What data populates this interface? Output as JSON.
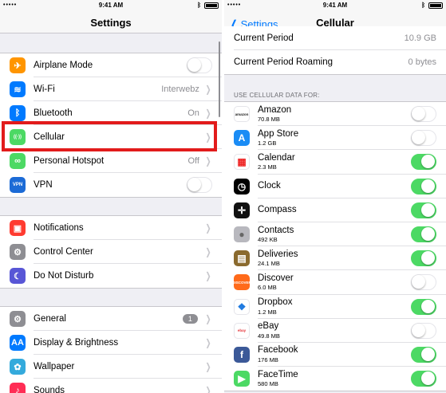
{
  "status": {
    "time": "9:41 AM",
    "carrier": "•••••"
  },
  "left": {
    "title": "Settings",
    "group1": [
      {
        "label": "Airplane Mode",
        "icon": "airplane-icon",
        "color": "#ff9500",
        "glyph": "✈",
        "type": "toggle",
        "on": false
      },
      {
        "label": "Wi-Fi",
        "icon": "wifi-icon",
        "color": "#007aff",
        "glyph": "≋",
        "type": "value",
        "value": "Interwebz"
      },
      {
        "label": "Bluetooth",
        "icon": "bluetooth-icon",
        "color": "#007aff",
        "glyph": "ᛒ",
        "type": "value",
        "value": "On"
      },
      {
        "label": "Cellular",
        "icon": "cellular-icon",
        "color": "#4cd964",
        "glyph": "((·))",
        "type": "chevron"
      },
      {
        "label": "Personal Hotspot",
        "icon": "hotspot-icon",
        "color": "#4cd964",
        "glyph": "∞",
        "type": "value",
        "value": "Off"
      },
      {
        "label": "VPN",
        "icon": "vpn-icon",
        "color": "#1c6bd6",
        "glyph": "VPN",
        "type": "toggle",
        "on": false
      }
    ],
    "group2": [
      {
        "label": "Notifications",
        "icon": "notifications-icon",
        "color": "#ff3b30",
        "glyph": "▣",
        "type": "chevron"
      },
      {
        "label": "Control Center",
        "icon": "control-center-icon",
        "color": "#8e8e93",
        "glyph": "⚙",
        "type": "chevron"
      },
      {
        "label": "Do Not Disturb",
        "icon": "moon-icon",
        "color": "#5856d6",
        "glyph": "☾",
        "type": "chevron"
      }
    ],
    "group3": [
      {
        "label": "General",
        "icon": "gear-icon",
        "color": "#8e8e93",
        "glyph": "⚙",
        "type": "badge",
        "badge": "1"
      },
      {
        "label": "Display & Brightness",
        "icon": "display-icon",
        "color": "#007aff",
        "glyph": "AA",
        "type": "chevron"
      },
      {
        "label": "Wallpaper",
        "icon": "wallpaper-icon",
        "color": "#34aadc",
        "glyph": "✿",
        "type": "chevron"
      },
      {
        "label": "Sounds",
        "icon": "sounds-icon",
        "color": "#ff2d55",
        "glyph": "♪",
        "type": "chevron"
      }
    ]
  },
  "right": {
    "back_label": "Settings",
    "title": "Cellular",
    "usage": [
      {
        "label": "Current Period",
        "value": "10.9 GB"
      },
      {
        "label": "Current Period Roaming",
        "value": "0 bytes"
      }
    ],
    "section_header": "USE CELLULAR DATA FOR:",
    "apps": [
      {
        "name": "Amazon",
        "size": "70.8 MB",
        "on": false,
        "icon": "amazon-icon",
        "color": "#ffffff",
        "fg": "#222",
        "glyph": "amazon"
      },
      {
        "name": "App Store",
        "size": "1.2 GB",
        "on": false,
        "icon": "app-store-icon",
        "color": "#1a8cf5",
        "fg": "#fff",
        "glyph": "A"
      },
      {
        "name": "Calendar",
        "size": "2.3 MB",
        "on": true,
        "icon": "calendar-icon",
        "color": "#ffffff",
        "fg": "#e22",
        "glyph": "▦"
      },
      {
        "name": "Clock",
        "size": "",
        "on": true,
        "icon": "clock-icon",
        "color": "#000000",
        "fg": "#fff",
        "glyph": "◷"
      },
      {
        "name": "Compass",
        "size": "",
        "on": true,
        "icon": "compass-icon",
        "color": "#111111",
        "fg": "#fff",
        "glyph": "✛"
      },
      {
        "name": "Contacts",
        "size": "492 KB",
        "on": true,
        "icon": "contacts-icon",
        "color": "#b8b8be",
        "fg": "#666",
        "glyph": "●"
      },
      {
        "name": "Deliveries",
        "size": "24.1 MB",
        "on": true,
        "icon": "deliveries-icon",
        "color": "#8a6a2e",
        "fg": "#fff",
        "glyph": "▤"
      },
      {
        "name": "Discover",
        "size": "6.0 MB",
        "on": false,
        "icon": "discover-icon",
        "color": "#ff6a1a",
        "fg": "#fff",
        "glyph": "DISCOVER"
      },
      {
        "name": "Dropbox",
        "size": "1.2 MB",
        "on": true,
        "icon": "dropbox-icon",
        "color": "#ffffff",
        "fg": "#1f7ae0",
        "glyph": "❖"
      },
      {
        "name": "eBay",
        "size": "49.8 MB",
        "on": false,
        "icon": "ebay-icon",
        "color": "#ffffff",
        "fg": "#e53238",
        "glyph": "ebay"
      },
      {
        "name": "Facebook",
        "size": "176 MB",
        "on": true,
        "icon": "facebook-icon",
        "color": "#3b5998",
        "fg": "#fff",
        "glyph": "f"
      },
      {
        "name": "FaceTime",
        "size": "580 MB",
        "on": true,
        "icon": "facetime-icon",
        "color": "#4cd964",
        "fg": "#fff",
        "glyph": "▶"
      }
    ]
  },
  "colors": {
    "accent": "#007aff",
    "toggle_on": "#4cd964",
    "highlight": "#e21b1b"
  }
}
